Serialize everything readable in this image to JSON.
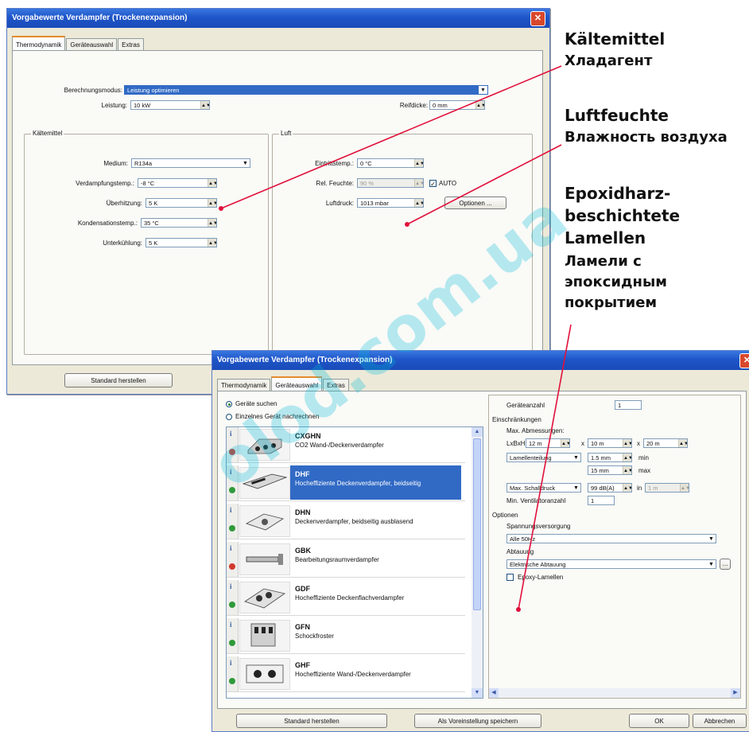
{
  "annotations": {
    "refrigerant_de": "Kältemittel",
    "refrigerant_ru": "Хладагент",
    "humidity_de": "Luftfeuchte",
    "humidity_ru": "Влажность воздуха",
    "epoxy_de_1": "Epoxidharz-",
    "epoxy_de_2": "beschichtete",
    "epoxy_de_3": "Lamellen",
    "epoxy_ru_1": "Ламели с",
    "epoxy_ru_2": "эпоксидным",
    "epoxy_ru_3": "покрытием"
  },
  "watermark": "olod.com.ua",
  "colors": {
    "title_bar": "#1e55c8",
    "selection": "#316ac5",
    "arrow": "#e0103a",
    "tab_highlight": "#e68b2c",
    "status_red": "#d23a2e",
    "status_green": "#2f9a3a"
  },
  "window1": {
    "title": "Vorgabewerte Verdampfer (Trockenexpansion)",
    "close_icon": "close-icon",
    "tabs": [
      "Thermodynamik",
      "Geräteauswahl",
      "Extras"
    ],
    "active_tab": 0,
    "mode_label": "Berechnungsmodus:",
    "mode_value": "Leistung optimieren",
    "power_label": "Leistung:",
    "power_value": "10 kW",
    "frost_label": "Reifdicke:",
    "frost_value": "0 mm",
    "refrigerant_group": {
      "title": "Kältemittel",
      "medium_label": "Medium:",
      "medium_value": "R134a",
      "evap_label": "Verdampfungstemp.:",
      "evap_value": "-8 °C",
      "superheat_label": "Überhitzung:",
      "superheat_value": "5 K",
      "cond_label": "Kondensationstemp.:",
      "cond_value": "35 °C",
      "subcool_label": "Unterkühlung:",
      "subcool_value": "5 K"
    },
    "air_group": {
      "title": "Luft",
      "inlet_label": "Eintrittstemp.:",
      "inlet_value": "0 °C",
      "humidity_label": "Rel. Feuchte:",
      "humidity_value": "90 %",
      "auto_label": "AUTO",
      "auto_checked": true,
      "pressure_label": "Luftdruck:",
      "pressure_value": "1013 mbar",
      "options_button": "Optionen ..."
    },
    "default_button": "Standard herstellen"
  },
  "window2": {
    "title": "Vorgabewerte Verdampfer (Trockenexpansion)",
    "close_icon": "close-icon",
    "tabs": [
      "Thermodynamik",
      "Geräteauswahl",
      "Extras"
    ],
    "active_tab": 1,
    "radio_search": "Geräte suchen",
    "radio_recalc": "Einzelnes Gerät nachrechnen",
    "radio_selected": 0,
    "info_icon": "info-icon",
    "devices": [
      {
        "code": "CXGHN",
        "desc": "CO2 Wand-/Deckenverdampfer",
        "status": "red",
        "selected": false
      },
      {
        "code": "DHF",
        "desc": "Hocheffiziente Deckenverdampfer, beidseitig",
        "status": "green",
        "selected": true
      },
      {
        "code": "DHN",
        "desc": "Deckenverdampfer, beidseitig ausblasend",
        "status": "green",
        "selected": false
      },
      {
        "code": "GBK",
        "desc": "Bearbeitungsraumverdampfer",
        "status": "red",
        "selected": false
      },
      {
        "code": "GDF",
        "desc": "Hocheffiziente Deckenflachverdampfer",
        "status": "green",
        "selected": false
      },
      {
        "code": "GFN",
        "desc": "Schockfroster",
        "status": "green",
        "selected": false
      },
      {
        "code": "GHF",
        "desc": "Hocheffiziente Wand-/Deckenverdampfer",
        "status": "green",
        "selected": false
      }
    ],
    "right": {
      "count_label": "Geräteanzahl",
      "count_value": "1",
      "limits_title": "Einschränkungen",
      "max_dims_label": "Max. Abmessungen:",
      "lxbxh_label": "LxBxH",
      "times": "x",
      "length_value": "12 m",
      "width_value": "10 m",
      "height_value": "20 m",
      "fin_select": "Lamellenteilung",
      "fin_min_value": "1.5 mm",
      "min_label": "min",
      "fin_max_value": "15 mm",
      "max_label": "max",
      "sound_select": "Max. Schalldruck",
      "sound_value": "99 dB(A)",
      "in_label": "in",
      "in_value": "1 m",
      "fans_label": "Min. Ventilatoranzahl",
      "fans_value": "1",
      "options_title": "Optionen",
      "supply_label": "Spannungsversorgung",
      "supply_value": "Alle 50Hz",
      "defrost_label": "Abtauung",
      "defrost_value": "Elektrische Abtauung",
      "epoxy_label": "Epoxy-Lamellen",
      "epoxy_checked": false
    },
    "default_button": "Standard herstellen",
    "save_button": "Als Voreinstellung speichern",
    "ok_button": "OK",
    "cancel_button": "Abbrechen"
  }
}
